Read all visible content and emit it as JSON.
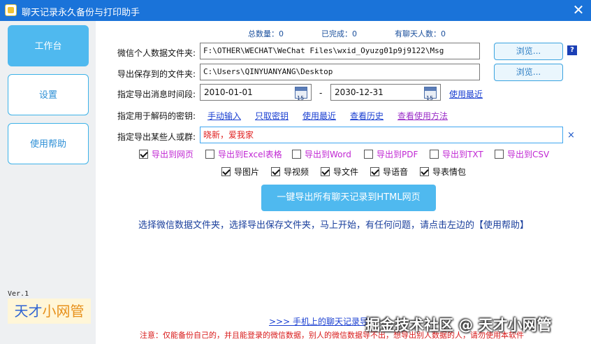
{
  "window": {
    "title": "聊天记录永久备份与打印助手",
    "close_glyph": "✕"
  },
  "sidebar": {
    "items": [
      {
        "label": "工作台",
        "active": true
      },
      {
        "label": "设置",
        "active": false
      },
      {
        "label": "使用帮助",
        "active": false
      }
    ],
    "version": "Ver.1",
    "logo_part1": "天才",
    "logo_part2": "小网管"
  },
  "stats": {
    "total_label": "总数量：0",
    "done_label": "已完成：0",
    "chats_label": "有聊天人数：0"
  },
  "form": {
    "wechat_dir_label": "微信个人数据文件夹:",
    "wechat_dir_value": "F:\\OTHER\\WECHAT\\WeChat Files\\wxid_Oyuzg01p9j9122\\Msg",
    "save_dir_label": "导出保存到的文件夹:",
    "save_dir_value": "C:\\Users\\QINYUANYANG\\Desktop",
    "browse_label": "浏览...",
    "help_q": "?",
    "date_label": "指定导出消息时间段:",
    "date_from": "2010-01-01",
    "date_sep": "-",
    "date_to": "2030-12-31",
    "date_recent_link": "使用最近",
    "key_label": "指定用于解码的密钥:",
    "key_links": [
      "手动输入",
      "只取密钥",
      "使用最近",
      "查看历史",
      "查看使用方法"
    ],
    "target_label": "指定导出某些人或群:",
    "target_value": "晓新，爱我家",
    "clear_glyph": "×"
  },
  "export_options": [
    {
      "label": "导出到网页",
      "checked": true
    },
    {
      "label": "导出到Excel表格",
      "checked": false
    },
    {
      "label": "导出到Word",
      "checked": false
    },
    {
      "label": "导出到PDF",
      "checked": false
    },
    {
      "label": "导出到TXT",
      "checked": false
    },
    {
      "label": "导出到CSV",
      "checked": false
    }
  ],
  "media_options": [
    {
      "label": "导图片",
      "checked": true
    },
    {
      "label": "导视频",
      "checked": true
    },
    {
      "label": "导文件",
      "checked": true
    },
    {
      "label": "导语音",
      "checked": true
    },
    {
      "label": "导表情包",
      "checked": true
    }
  ],
  "main_button_label": "一键导出所有聊天记录到HTML网页",
  "hint_text": "选择微信数据文件夹，选择导出保存文件夹，马上开始，有任何问题，请点击左边的【使用帮助】",
  "mobile_link": ">>>  手机上的聊天记录导出",
  "notice_text": "注意：仅能备份自己的，并且能登录的微信数据，别人的微信数据导不出，想导出别人数据的人，请勿使用本软件",
  "watermark": "掘金技术社区 @ 天才小网管"
}
